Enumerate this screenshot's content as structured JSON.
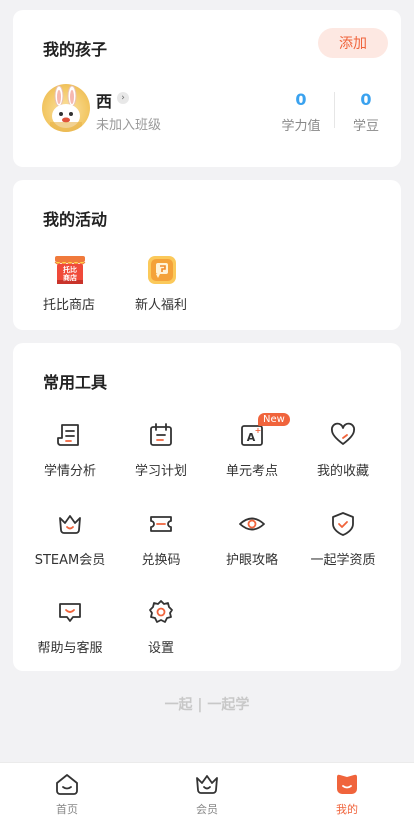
{
  "child_section": {
    "title": "我的孩子",
    "add_label": "添加",
    "child": {
      "name": "西",
      "class_status": "未加入班级"
    },
    "stats": [
      {
        "value": "0",
        "label": "学力值"
      },
      {
        "value": "0",
        "label": "学豆"
      }
    ]
  },
  "activity_section": {
    "title": "我的活动",
    "items": [
      {
        "label": "托比商店",
        "icon": "shop-icon",
        "icon_text": "托比商店"
      },
      {
        "label": "新人福利",
        "icon": "gift-icon"
      }
    ]
  },
  "tools_section": {
    "title": "常用工具",
    "items": [
      {
        "label": "学情分析",
        "icon": "report-icon"
      },
      {
        "label": "学习计划",
        "icon": "calendar-icon"
      },
      {
        "label": "单元考点",
        "icon": "exam-icon",
        "badge": "New"
      },
      {
        "label": "我的收藏",
        "icon": "heart-icon"
      },
      {
        "label": "STEAM会员",
        "icon": "crown-icon"
      },
      {
        "label": "兑换码",
        "icon": "ticket-icon"
      },
      {
        "label": "护眼攻略",
        "icon": "eye-icon"
      },
      {
        "label": "一起学资质",
        "icon": "shield-icon"
      },
      {
        "label": "帮助与客服",
        "icon": "chat-icon"
      },
      {
        "label": "设置",
        "icon": "gear-icon"
      }
    ]
  },
  "brand": {
    "text": "一起 | 一起学"
  },
  "bottom_nav": {
    "items": [
      {
        "label": "首页",
        "icon": "home-icon"
      },
      {
        "label": "会员",
        "icon": "crown-icon"
      },
      {
        "label": "我的",
        "icon": "profile-icon",
        "active": true
      }
    ]
  },
  "colors": {
    "accent": "#f0643c",
    "stat_blue": "#3aa2ef",
    "background": "#f2f2f4"
  }
}
